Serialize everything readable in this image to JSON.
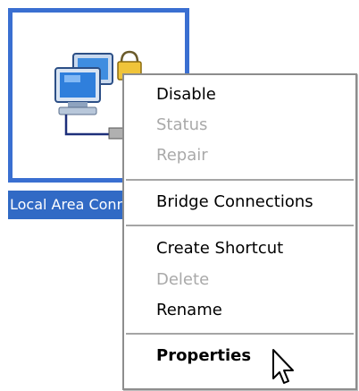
{
  "desktop_icon": {
    "label": "Local Area Connection",
    "icon_name": "network-connection-icon",
    "lock_icon_name": "lock-icon",
    "selection_color": "#316ac5"
  },
  "context_menu": {
    "items": [
      {
        "label": "Disable",
        "enabled": true
      },
      {
        "label": "Status",
        "enabled": false
      },
      {
        "label": "Repair",
        "enabled": false
      },
      {
        "label": "Bridge Connections",
        "enabled": true
      },
      {
        "label": "Create Shortcut",
        "enabled": true
      },
      {
        "label": "Delete",
        "enabled": false
      },
      {
        "label": "Rename",
        "enabled": true
      },
      {
        "label": "Properties",
        "enabled": true,
        "default": true
      }
    ]
  },
  "cursor": {
    "icon_name": "arrow-cursor-icon"
  }
}
